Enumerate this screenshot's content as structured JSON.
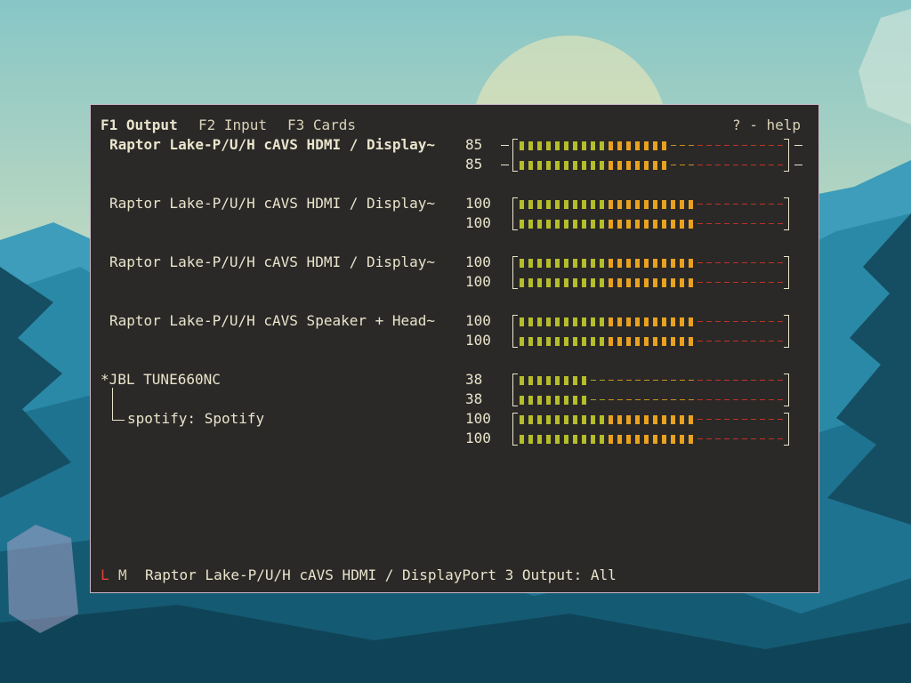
{
  "colors": {
    "volume_low": "#b5bd2a",
    "volume_mid": "#e9a21f",
    "volume_over": "#cf3328",
    "mute_red": "#e0413a",
    "text": "#e9e4cc",
    "bg": "#2b2927"
  },
  "tabs": [
    {
      "label": "F1 Output",
      "active": true
    },
    {
      "label": "F2 Input",
      "active": false
    },
    {
      "label": "F3 Cards",
      "active": false
    }
  ],
  "help": "? - help",
  "devices": [
    {
      "name": "Raptor Lake-P/U/H cAVS HDMI / Display~",
      "selected": true,
      "volumes": [
        "85",
        "85"
      ],
      "level": 85,
      "kind": "device"
    },
    {
      "name": "Raptor Lake-P/U/H cAVS HDMI / Display~",
      "selected": false,
      "volumes": [
        "100",
        "100"
      ],
      "level": 100,
      "kind": "device"
    },
    {
      "name": "Raptor Lake-P/U/H cAVS HDMI / Display~",
      "selected": false,
      "volumes": [
        "100",
        "100"
      ],
      "level": 100,
      "kind": "device"
    },
    {
      "name": "Raptor Lake-P/U/H cAVS Speaker + Head~",
      "selected": false,
      "volumes": [
        "100",
        "100"
      ],
      "level": 100,
      "kind": "device"
    },
    {
      "name": "*JBL TUNE660NC",
      "selected": false,
      "volumes": [
        "38",
        "38"
      ],
      "level": 38,
      "kind": "device"
    },
    {
      "name": "spotify: Spotify",
      "selected": false,
      "volumes": [
        "100",
        "100"
      ],
      "level": 100,
      "kind": "stream"
    }
  ],
  "status": {
    "lock": "L",
    "mute": "M",
    "text": "Raptor Lake-P/U/H cAVS HDMI / DisplayPort 3 Output: All"
  }
}
